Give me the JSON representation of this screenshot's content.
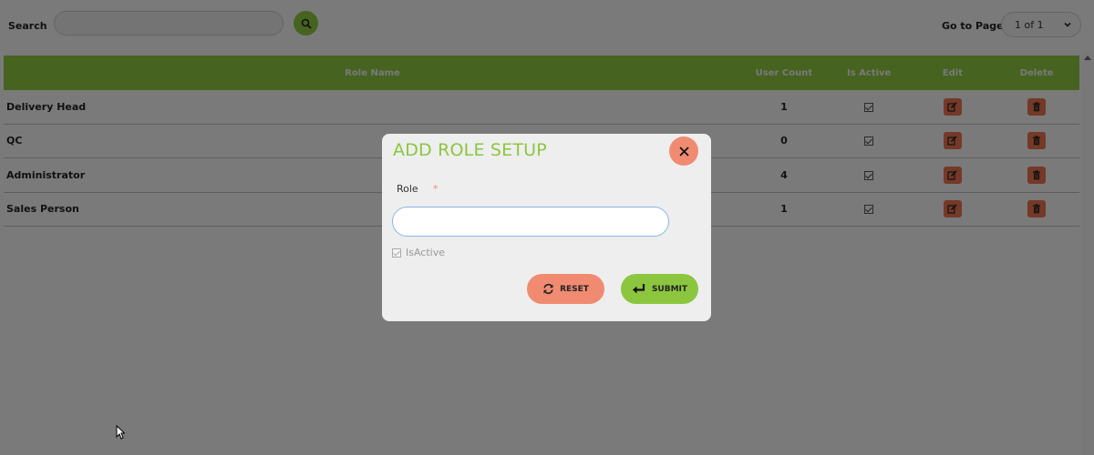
{
  "search": {
    "label": "Search",
    "value": "",
    "button_icon": "search-icon"
  },
  "pagination": {
    "label": "Go to Page",
    "selected": "1 of 1"
  },
  "table": {
    "columns": [
      "Role Name",
      "User Count",
      "Is Active",
      "Edit",
      "Delete"
    ],
    "rows": [
      {
        "role": "Delivery Head",
        "count": "1",
        "active": true
      },
      {
        "role": "QC",
        "count": "0",
        "active": true
      },
      {
        "role": "Administrator",
        "count": "4",
        "active": true
      },
      {
        "role": "Sales Person",
        "count": "1",
        "active": true
      }
    ]
  },
  "modal": {
    "title": "ADD ROLE SETUP",
    "role_label": "Role",
    "required_mark": "*",
    "role_value": "",
    "isactive_label": "IsActive",
    "isactive_checked": true,
    "reset_label": "RESET",
    "submit_label": "SUBMIT"
  },
  "colors": {
    "accent_green": "#8cc63f",
    "accent_salmon": "#f08b72",
    "action_orange": "#e8734f"
  }
}
